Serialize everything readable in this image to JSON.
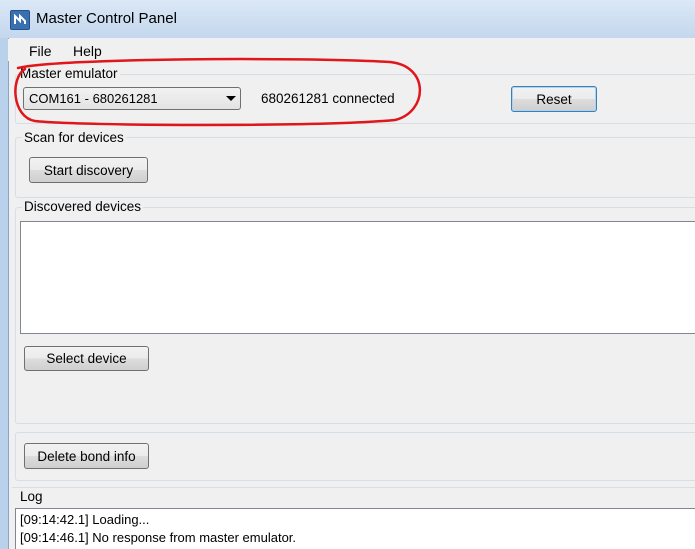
{
  "window": {
    "title": "Master Control Panel",
    "icon": "app-logo-icon"
  },
  "menu": {
    "items": [
      {
        "label": "File"
      },
      {
        "label": "Help"
      }
    ]
  },
  "master_emulator": {
    "group_title": "Master emulator",
    "selected_port": "COM161 - 680261281",
    "status_text": "680261281 connected",
    "reset_label": "Reset"
  },
  "scan": {
    "group_title": "Scan for devices",
    "start_label": "Start discovery"
  },
  "discovered": {
    "group_title": "Discovered devices",
    "items": [],
    "select_label": "Select device"
  },
  "bond": {
    "delete_label": "Delete bond info"
  },
  "log": {
    "title": "Log",
    "lines": [
      "[09:14:42.1] Loading...",
      "[09:14:46.1] No response from master emulator."
    ]
  },
  "annotation": {
    "color": "#e0161b"
  }
}
